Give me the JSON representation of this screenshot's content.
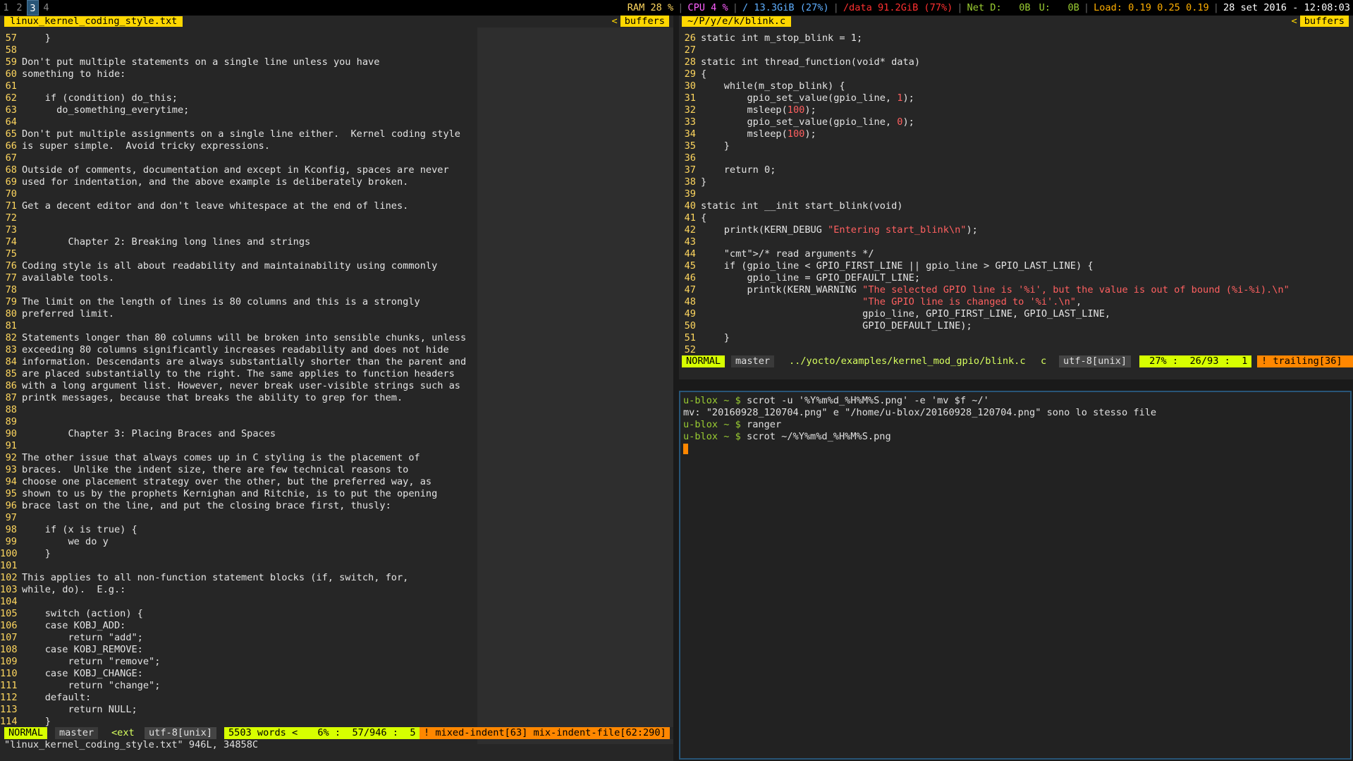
{
  "topbar": {
    "workspaces": [
      "1",
      "2",
      "3",
      "4"
    ],
    "active_workspace": "3",
    "ram": "RAM 28 %",
    "cpu": "CPU 4 %",
    "root_disk": "/ 13.3GiB (27%)",
    "data_disk": "/data 91.2GiB (77%)",
    "net_down": "Net D:   0B",
    "net_up": "U:   0B",
    "load": "Load: 0.19 0.25 0.19",
    "datetime": "28 set 2016 - 12:08:03",
    "colors": {
      "ram": "#ffd75f",
      "cpu": "#ff5fff",
      "root": "#5fafff",
      "data": "#ff3030",
      "net": "#9acd32",
      "load": "#ffaf00"
    }
  },
  "left_pane": {
    "tab_title": "linux_kernel_coding_style.txt",
    "buffers_label": "buffers",
    "lines": [
      [
        "57",
        "    }"
      ],
      [
        "58",
        ""
      ],
      [
        "59",
        "Don't put multiple statements on a single line unless you have"
      ],
      [
        "60",
        "something to hide:"
      ],
      [
        "61",
        ""
      ],
      [
        "62",
        "    if (condition) do_this;"
      ],
      [
        "63",
        "      do_something_everytime;"
      ],
      [
        "64",
        ""
      ],
      [
        "65",
        "Don't put multiple assignments on a single line either.  Kernel coding style"
      ],
      [
        "66",
        "is super simple.  Avoid tricky expressions."
      ],
      [
        "67",
        ""
      ],
      [
        "68",
        "Outside of comments, documentation and except in Kconfig, spaces are never"
      ],
      [
        "69",
        "used for indentation, and the above example is deliberately broken."
      ],
      [
        "70",
        ""
      ],
      [
        "71",
        "Get a decent editor and don't leave whitespace at the end of lines."
      ],
      [
        "72",
        ""
      ],
      [
        "73",
        ""
      ],
      [
        "74",
        "        Chapter 2: Breaking long lines and strings"
      ],
      [
        "75",
        ""
      ],
      [
        "76",
        "Coding style is all about readability and maintainability using commonly"
      ],
      [
        "77",
        "available tools."
      ],
      [
        "78",
        ""
      ],
      [
        "79",
        "The limit on the length of lines is 80 columns and this is a strongly"
      ],
      [
        "80",
        "preferred limit."
      ],
      [
        "81",
        ""
      ],
      [
        "82",
        "Statements longer than 80 columns will be broken into sensible chunks, unless"
      ],
      [
        "83",
        "exceeding 80 columns significantly increases readability and does not hide"
      ],
      [
        "84",
        "information. Descendants are always substantially shorter than the parent and"
      ],
      [
        "85",
        "are placed substantially to the right. The same applies to function headers"
      ],
      [
        "86",
        "with a long argument list. However, never break user-visible strings such as"
      ],
      [
        "87",
        "printk messages, because that breaks the ability to grep for them."
      ],
      [
        "88",
        ""
      ],
      [
        "89",
        ""
      ],
      [
        "90",
        "        Chapter 3: Placing Braces and Spaces"
      ],
      [
        "91",
        ""
      ],
      [
        "92",
        "The other issue that always comes up in C styling is the placement of"
      ],
      [
        "93",
        "braces.  Unlike the indent size, there are few technical reasons to"
      ],
      [
        "94",
        "choose one placement strategy over the other, but the preferred way, as"
      ],
      [
        "95",
        "shown to us by the prophets Kernighan and Ritchie, is to put the opening"
      ],
      [
        "96",
        "brace last on the line, and put the closing brace first, thusly:"
      ],
      [
        "97",
        ""
      ],
      [
        "98",
        "    if (x is true) {"
      ],
      [
        "99",
        "        we do y"
      ],
      [
        "100",
        "    }"
      ],
      [
        "101",
        ""
      ],
      [
        "102",
        "This applies to all non-function statement blocks (if, switch, for,"
      ],
      [
        "103",
        "while, do).  E.g.:"
      ],
      [
        "104",
        ""
      ],
      [
        "105",
        "    switch (action) {"
      ],
      [
        "106",
        "    case KOBJ_ADD:"
      ],
      [
        "107",
        "        return \"add\";"
      ],
      [
        "108",
        "    case KOBJ_REMOVE:"
      ],
      [
        "109",
        "        return \"remove\";"
      ],
      [
        "110",
        "    case KOBJ_CHANGE:"
      ],
      [
        "111",
        "        return \"change\";"
      ],
      [
        "112",
        "    default:"
      ],
      [
        "113",
        "        return NULL;"
      ],
      [
        "114",
        "    }"
      ]
    ],
    "statusline": {
      "mode": "NORMAL",
      "branch": "master",
      "ext": "<ext",
      "encoding": "utf-8[unix]",
      "words": "5503 words <",
      "position": "  6% :  57/946 :  5",
      "warnings": "! mixed-indent[63] mix-indent-file[62:290]"
    },
    "cmdline": "\"linux_kernel_coding_style.txt\" 946L, 34858C"
  },
  "right_pane": {
    "tab_title": "~/P/y/e/k/blink.c",
    "buffers_label": "buffers",
    "lines": [
      [
        "26",
        "static int m_stop_blink = 1;"
      ],
      [
        "27",
        ""
      ],
      [
        "28",
        "static int thread_function(void* data)"
      ],
      [
        "29",
        "{"
      ],
      [
        "30",
        "    while(m_stop_blink) {"
      ],
      [
        "31",
        "        gpio_set_value(gpio_line, 1);"
      ],
      [
        "32",
        "        msleep(100);"
      ],
      [
        "33",
        "        gpio_set_value(gpio_line, 0);"
      ],
      [
        "34",
        "        msleep(100);"
      ],
      [
        "35",
        "    }"
      ],
      [
        "36",
        ""
      ],
      [
        "37",
        "    return 0;"
      ],
      [
        "38",
        "}"
      ],
      [
        "39",
        ""
      ],
      [
        "40",
        "static int __init start_blink(void)"
      ],
      [
        "41",
        "{"
      ],
      [
        "42",
        "    printk(KERN_DEBUG \"Entering start_blink\\n\");"
      ],
      [
        "43",
        ""
      ],
      [
        "44",
        "    /* read arguments */"
      ],
      [
        "45",
        "    if (gpio_line < GPIO_FIRST_LINE || gpio_line > GPIO_LAST_LINE) {"
      ],
      [
        "46",
        "        gpio_line = GPIO_DEFAULT_LINE;"
      ],
      [
        "47",
        "        printk(KERN_WARNING \"The selected GPIO line is '%i', but the value is out of bound (%i-%i).\\n\""
      ],
      [
        "48",
        "                            \"The GPIO line is changed to '%i'.\\n\","
      ],
      [
        "49",
        "                            gpio_line, GPIO_FIRST_LINE, GPIO_LAST_LINE,"
      ],
      [
        "50",
        "                            GPIO_DEFAULT_LINE);"
      ],
      [
        "51",
        "    }"
      ],
      [
        "52",
        ""
      ]
    ],
    "statusline": {
      "mode": "NORMAL",
      "branch": "master",
      "path": "../yocto/examples/kernel_mod_gpio/blink.c",
      "filetype": "c",
      "encoding": "utf-8[unix]",
      "position": " 27% :  26/93 :  1",
      "warnings": "! trailing[36]"
    }
  },
  "terminal": {
    "lines": [
      {
        "prompt": "u-blox ~ $ ",
        "text": "scrot -u '%Y%m%d_%H%M%S.png' -e 'mv $f ~/'"
      },
      {
        "prompt": "",
        "text": "mv: \"20160928_120704.png\" e \"/home/u-blox/20160928_120704.png\" sono lo stesso file"
      },
      {
        "prompt": "u-blox ~ $ ",
        "text": "ranger"
      },
      {
        "prompt": "u-blox ~ $ ",
        "text": "scrot ~/%Y%m%d_%H%M%S.png"
      }
    ]
  }
}
